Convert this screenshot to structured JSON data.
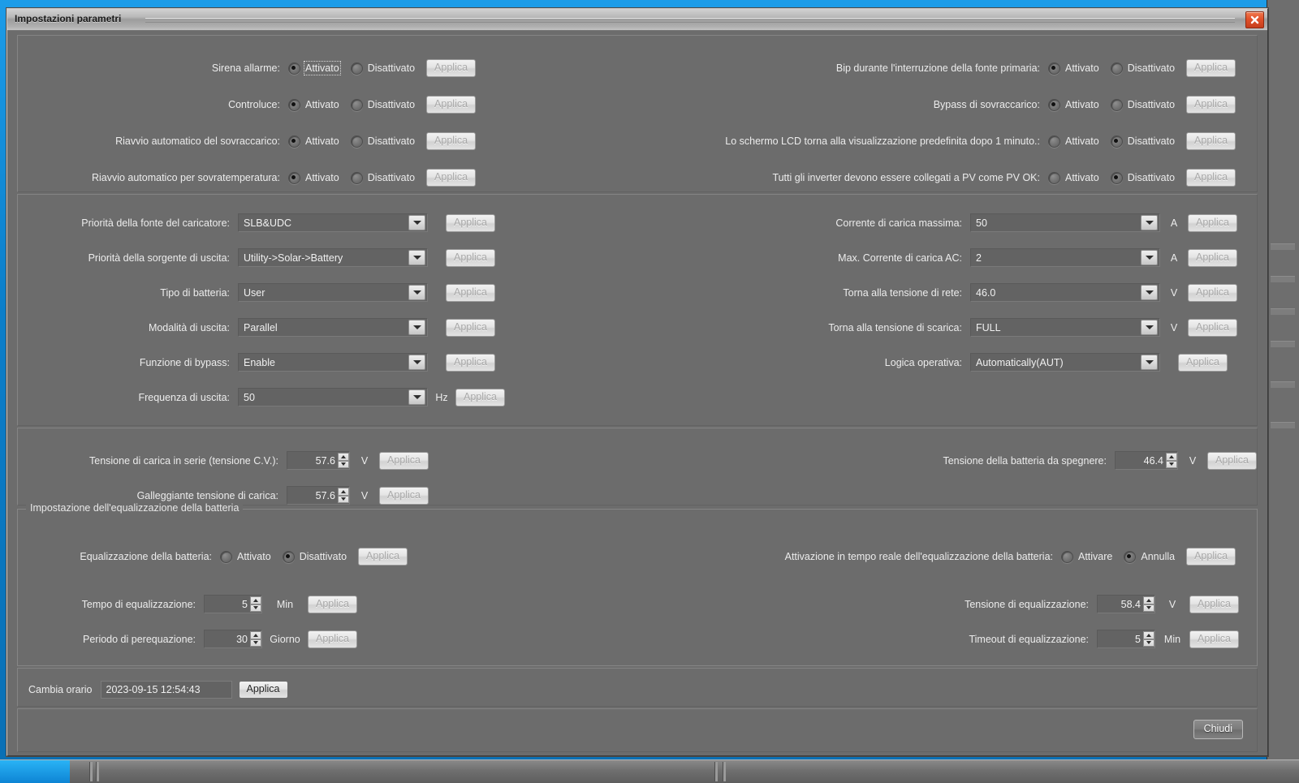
{
  "window": {
    "title": "Impostazioni parametri",
    "close_icon": "close-icon",
    "close_button_label": "Chiudi"
  },
  "apply_label": "Applica",
  "radio_options": {
    "enabled": "Attivato",
    "disabled": "Disattivato",
    "activate": "Attivare",
    "cancel": "Annulla"
  },
  "toggles_left": [
    {
      "label": "Sirena allarme:",
      "on": "Attivato",
      "off": "Disattivato",
      "selected": "on",
      "focused": true,
      "apply": "Applica",
      "apply_enabled": false
    },
    {
      "label": "Controluce:",
      "on": "Attivato",
      "off": "Disattivato",
      "selected": "on",
      "focused": false,
      "apply": "Applica",
      "apply_enabled": false
    },
    {
      "label": "Riavvio automatico del sovraccarico:",
      "on": "Attivato",
      "off": "Disattivato",
      "selected": "on",
      "focused": false,
      "apply": "Applica",
      "apply_enabled": false
    },
    {
      "label": "Riavvio automatico per sovratemperatura:",
      "on": "Attivato",
      "off": "Disattivato",
      "selected": "on",
      "focused": false,
      "apply": "Applica",
      "apply_enabled": false
    }
  ],
  "toggles_right": [
    {
      "label": "Bip durante l'interruzione della fonte primaria:",
      "on": "Attivato",
      "off": "Disattivato",
      "selected": "on",
      "apply": "Applica",
      "apply_enabled": false
    },
    {
      "label": "Bypass di sovraccarico:",
      "on": "Attivato",
      "off": "Disattivato",
      "selected": "on",
      "apply": "Applica",
      "apply_enabled": false
    },
    {
      "label": "Lo schermo LCD torna alla visualizzazione predefinita dopo 1 minuto.:",
      "on": "Attivato",
      "off": "Disattivato",
      "selected": "off",
      "apply": "Applica",
      "apply_enabled": false
    },
    {
      "label": "Tutti gli inverter devono essere collegati a PV come PV OK:",
      "on": "Attivato",
      "off": "Disattivato",
      "selected": "off",
      "apply": "Applica",
      "apply_enabled": false
    }
  ],
  "combos_left": [
    {
      "label": "Priorità della fonte del caricatore:",
      "value": "SLB&UDC",
      "unit": "",
      "apply": "Applica",
      "apply_enabled": false
    },
    {
      "label": "Priorità della sorgente di uscita:",
      "value": "Utility->Solar->Battery",
      "unit": "",
      "apply": "Applica",
      "apply_enabled": false
    },
    {
      "label": "Tipo di batteria:",
      "value": "User",
      "unit": "",
      "apply": "Applica",
      "apply_enabled": false
    },
    {
      "label": "Modalità di uscita:",
      "value": "Parallel",
      "unit": "",
      "apply": "Applica",
      "apply_enabled": false
    },
    {
      "label": "Funzione di bypass:",
      "value": "Enable",
      "unit": "",
      "apply": "Applica",
      "apply_enabled": false
    },
    {
      "label": "Frequenza di uscita:",
      "value": "50",
      "unit": "Hz",
      "apply": "Applica",
      "apply_enabled": false
    }
  ],
  "combos_right": [
    {
      "label": "Corrente di carica massima:",
      "value": "50",
      "unit": "A",
      "apply": "Applica",
      "apply_enabled": false
    },
    {
      "label": "Max. Corrente di carica AC:",
      "value": "2",
      "unit": "A",
      "apply": "Applica",
      "apply_enabled": false
    },
    {
      "label": "Torna alla tensione di rete:",
      "value": "46.0",
      "unit": "V",
      "apply": "Applica",
      "apply_enabled": false
    },
    {
      "label": "Torna alla tensione di scarica:",
      "value": "FULL",
      "unit": "V",
      "apply": "Applica",
      "apply_enabled": false
    },
    {
      "label": "Logica operativa:",
      "value": "Automatically(AUT)",
      "unit": "",
      "apply": "Applica",
      "apply_enabled": false
    }
  ],
  "spinners_left": [
    {
      "label": "Tensione di carica in serie (tensione C.V.):",
      "value": "57.6",
      "unit": "V",
      "apply": "Applica",
      "apply_enabled": false
    },
    {
      "label": "Galleggiante tensione di carica:",
      "value": "57.6",
      "unit": "V",
      "apply": "Applica",
      "apply_enabled": false
    }
  ],
  "spinners_right": [
    {
      "label": "Tensione della batteria da spegnere:",
      "value": "46.4",
      "unit": "V",
      "apply": "Applica",
      "apply_enabled": false
    }
  ],
  "equalization": {
    "group_title": "Impostazione dell'equalizzazione della batteria",
    "toggle_left": {
      "label": "Equalizzazione della batteria:",
      "on": "Attivato",
      "off": "Disattivato",
      "selected": "off",
      "apply": "Applica",
      "apply_enabled": false
    },
    "toggle_right": {
      "label": "Attivazione in tempo reale dell'equalizzazione della batteria:",
      "on": "Attivare",
      "off": "Annulla",
      "selected": "off",
      "apply": "Applica",
      "apply_enabled": false
    },
    "spinners_left": [
      {
        "label": "Tempo di equalizzazione:",
        "value": "5",
        "unit": "Min",
        "apply": "Applica",
        "apply_enabled": false
      },
      {
        "label": "Periodo di perequazione:",
        "value": "30",
        "unit": "Giorno",
        "apply": "Applica",
        "apply_enabled": false
      }
    ],
    "spinners_right": [
      {
        "label": "Tensione di equalizzazione:",
        "value": "58.4",
        "unit": "V",
        "apply": "Applica",
        "apply_enabled": false
      },
      {
        "label": "Timeout di equalizzazione:",
        "value": "5",
        "unit": "Min",
        "apply": "Applica",
        "apply_enabled": false
      }
    ]
  },
  "datetime": {
    "label": "Cambia orario",
    "value": "2023-09-15 12:54:43",
    "apply": "Applica",
    "apply_enabled": true
  },
  "colors": {
    "window_bg": "#6c6c6c",
    "desktop": "#0f8fe0",
    "close_red": "#e1512a",
    "text": "#ececec"
  }
}
